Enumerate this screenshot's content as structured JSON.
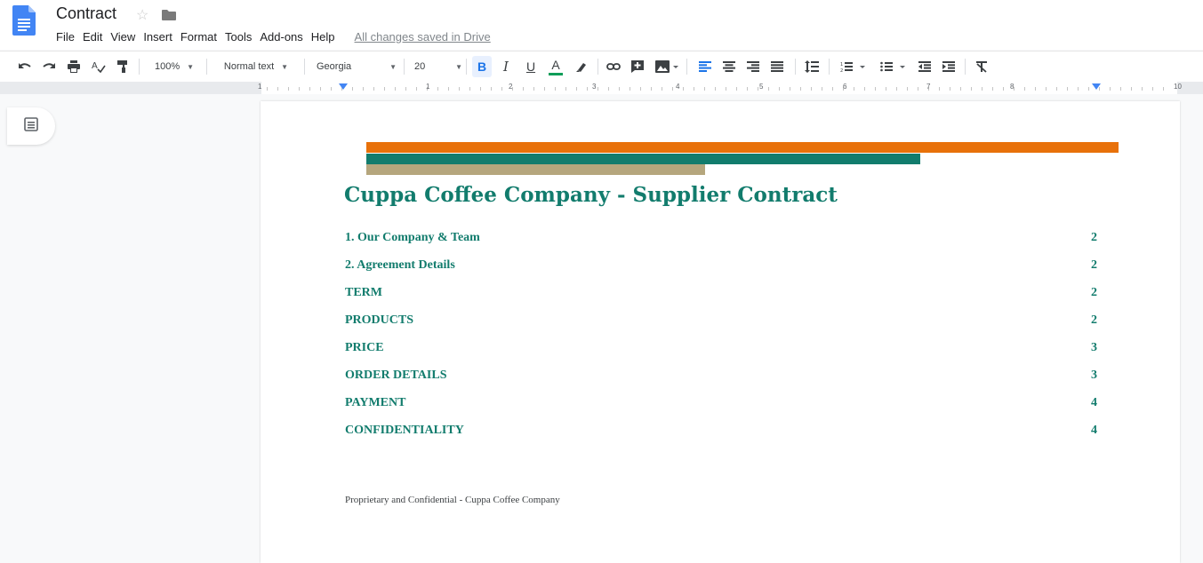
{
  "app": {
    "doc_title": "Contract",
    "menu": [
      "File",
      "Edit",
      "View",
      "Insert",
      "Format",
      "Tools",
      "Add-ons",
      "Help"
    ],
    "save_status": "All changes saved in Drive"
  },
  "toolbar": {
    "zoom": "100%",
    "style": "Normal text",
    "font": "Georgia",
    "font_size": "20",
    "bold": "B",
    "italic": "I",
    "underline": "U",
    "text_color": "A",
    "text_color_value": "#0f9d58"
  },
  "ruler": {
    "numbers": [
      "1",
      "1",
      "2",
      "3",
      "4",
      "5",
      "6",
      "7",
      "8",
      "10"
    ]
  },
  "document": {
    "heading": "Cuppa Coffee Company - Supplier Contract",
    "bar_colors": [
      "#e8710a",
      "#127c6d",
      "#b5a67d"
    ],
    "toc": [
      {
        "label": "1. Our Company & Team",
        "page": "2"
      },
      {
        "label": "2. Agreement Details",
        "page": "2"
      },
      {
        "label": "TERM",
        "page": "2"
      },
      {
        "label": "PRODUCTS",
        "page": "2"
      },
      {
        "label": "PRICE",
        "page": "3"
      },
      {
        "label": "ORDER DETAILS",
        "page": "3"
      },
      {
        "label": "PAYMENT",
        "page": "4"
      },
      {
        "label": "CONFIDENTIALITY",
        "page": "4"
      }
    ],
    "footer": "Proprietary and Confidential - Cuppa Coffee Company"
  }
}
